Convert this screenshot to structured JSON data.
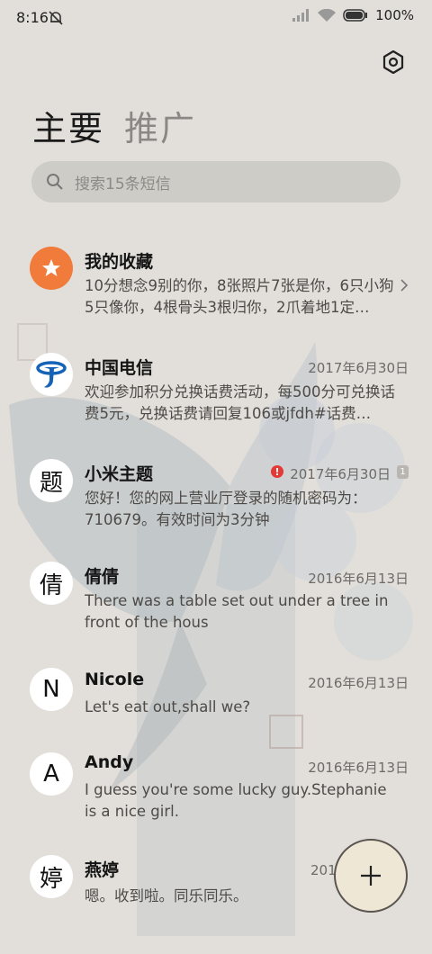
{
  "status_bar": {
    "time": "8:16",
    "battery": "100%",
    "icons": [
      "mute-bell-icon",
      "signal-icon",
      "wifi-icon",
      "battery-icon"
    ]
  },
  "header": {
    "tabs": [
      {
        "label": "主要",
        "active": true
      },
      {
        "label": "推广",
        "active": false
      }
    ],
    "settings_icon": "gear-icon"
  },
  "search": {
    "placeholder": "搜索15条短信",
    "icon": "search-icon"
  },
  "conversations": [
    {
      "avatar": "star-icon",
      "name": "我的收藏",
      "date": "",
      "preview": "10分想念9别的你，8张照片7张是你，6只小狗5只像你，4根骨头3根归你，2爪着地1定…",
      "chevron": true
    },
    {
      "avatar": "china-telecom-logo",
      "name": "中国电信",
      "date": "2017年6月30日",
      "preview": "欢迎参加积分兑换话费活动，每500分可兑换话费5元，兑换话费请回复106或jfdh#话费…"
    },
    {
      "avatar": "题",
      "name": "小米主题",
      "date": "2017年6月30日",
      "preview": "您好！您的网上营业厅登录的随机密码为：710679。有效时间为3分钟",
      "error": "!",
      "sim": "1"
    },
    {
      "avatar": "倩",
      "name": "倩倩",
      "date": "2016年6月13日",
      "preview": "There was a table set out under a tree in front of the hous"
    },
    {
      "avatar": "N",
      "name": "Nicole",
      "date": "2016年6月13日",
      "preview": "Let's eat out,shall we?"
    },
    {
      "avatar": "A",
      "name": "Andy",
      "date": "2016年6月13日",
      "preview": "I guess you're some lucky guy.Stephanie is a nice girl."
    },
    {
      "avatar": "婷",
      "name": "燕婷",
      "date": "201",
      "preview": "嗯。收到啦。同乐同乐。"
    }
  ],
  "fab": {
    "icon": "plus-icon"
  },
  "colors": {
    "background": "#e2dfda",
    "favorite": "#f07b3a",
    "telecom_blue": "#1463b6",
    "error": "#e53935"
  }
}
